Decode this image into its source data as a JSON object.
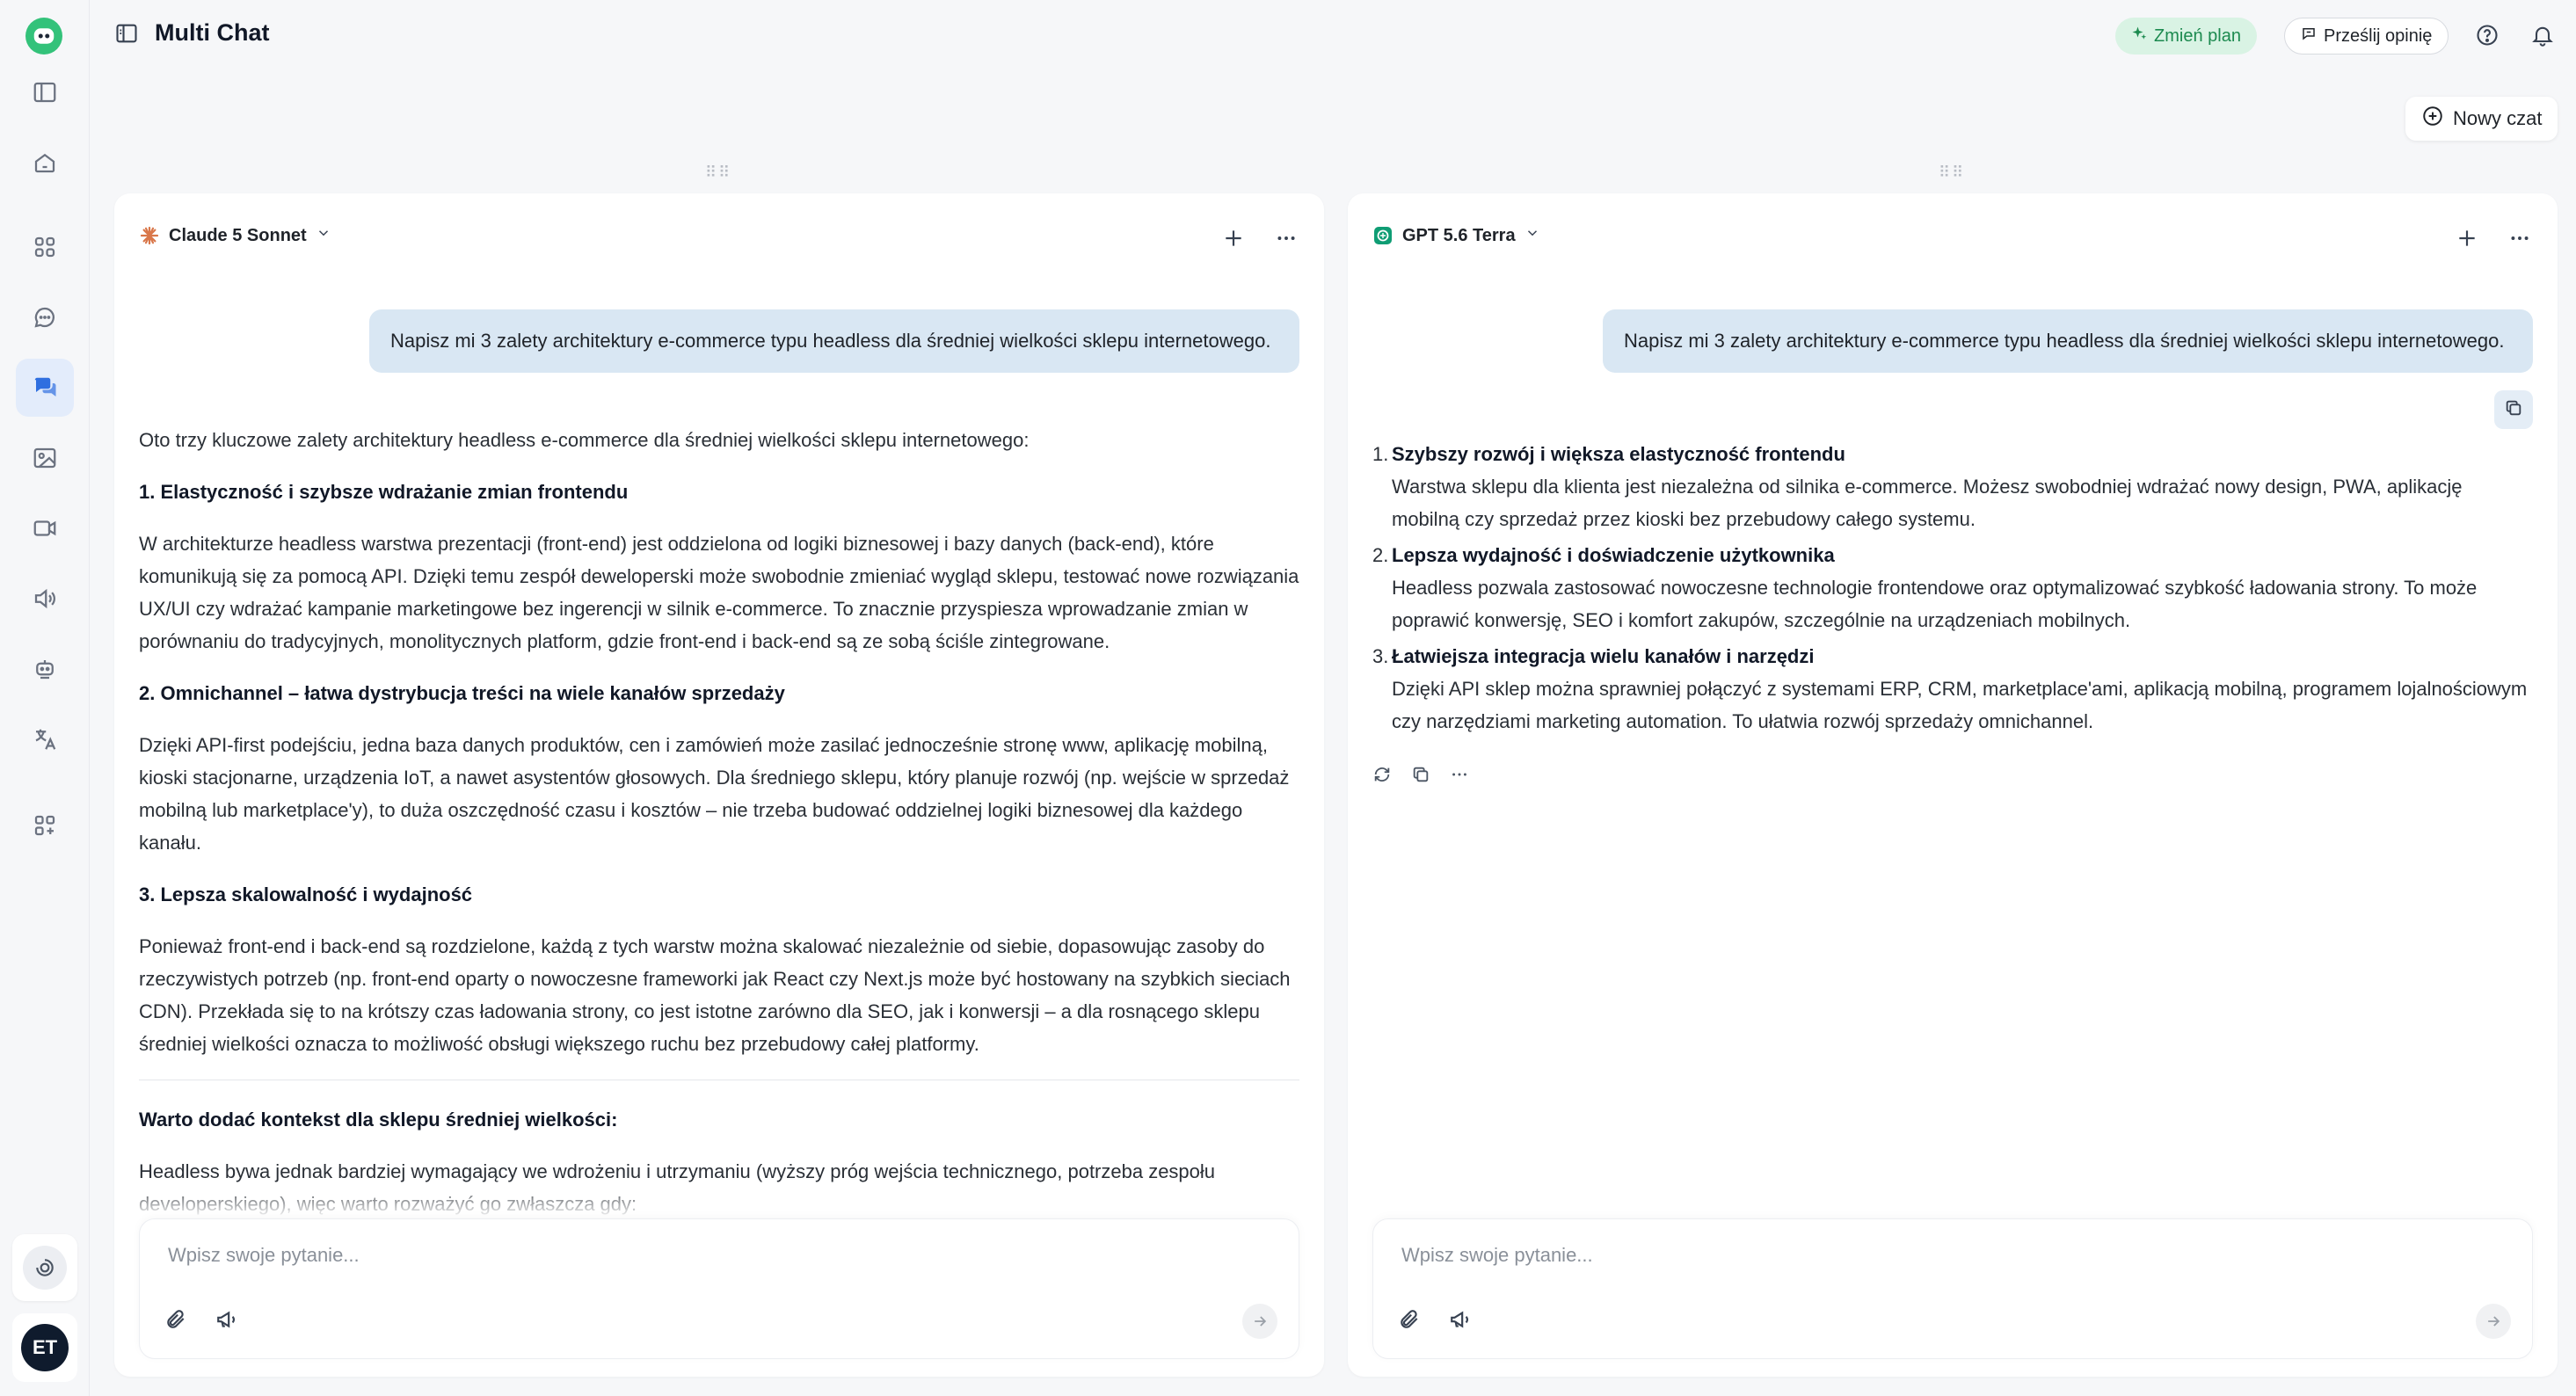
{
  "app": {
    "title": "Multi Chat"
  },
  "header": {
    "plan_label": "Zmień plan",
    "feedback_label": "Prześlij opinię",
    "new_chat_label": "Nowy czat"
  },
  "user": {
    "initials": "ET"
  },
  "colors": {
    "accent": "#2f6fe0",
    "plan_bg": "#d9f3e4",
    "plan_text": "#1c8a4f",
    "bubble": "#d9e7f3"
  },
  "sidebar": {
    "items": [
      {
        "icon": "panel-toggle-icon"
      },
      {
        "icon": "home-icon"
      },
      {
        "icon": "grid-icon"
      },
      {
        "icon": "chat-icon"
      },
      {
        "icon": "multi-chat-icon",
        "active": true
      },
      {
        "icon": "image-icon"
      },
      {
        "icon": "video-icon"
      },
      {
        "icon": "audio-icon"
      },
      {
        "icon": "robot-icon"
      },
      {
        "icon": "translate-icon"
      },
      {
        "icon": "add-apps-icon"
      }
    ]
  },
  "panels": [
    {
      "model": "Claude 5 Sonnet",
      "prompt": "Napisz mi 3 zalety architektury e-commerce typu headless dla średniej wielkości sklepu internetowego.",
      "intro": "Oto trzy kluczowe zalety architektury headless e-commerce dla średniej wielkości sklepu internetowego:",
      "sections": [
        {
          "heading": "1. Elastyczność i szybsze wdrażanie zmian frontendu",
          "body": "W architekturze headless warstwa prezentacji (front-end) jest oddzielona od logiki biznesowej i bazy danych (back-end), które komunikują się za pomocą API. Dzięki temu zespół deweloperski może swobodnie zmieniać wygląd sklepu, testować nowe rozwiązania UX/UI czy wdrażać kampanie marketingowe bez ingerencji w silnik e-commerce. To znacznie przyspiesza wprowadzanie zmian w porównaniu do tradycyjnych, monolitycznych platform, gdzie front-end i back-end są ze sobą ściśle zintegrowane."
        },
        {
          "heading": "2. Omnichannel – łatwa dystrybucja treści na wiele kanałów sprzedaży",
          "body": "Dzięki API-first podejściu, jedna baza danych produktów, cen i zamówień może zasilać jednocześnie stronę www, aplikację mobilną, kioski stacjonarne, urządzenia IoT, a nawet asystentów głosowych. Dla średniego sklepu, który planuje rozwój (np. wejście w sprzedaż mobilną lub marketplace'y), to duża oszczędność czasu i kosztów – nie trzeba budować oddzielnej logiki biznesowej dla każdego kanału."
        },
        {
          "heading": "3. Lepsza skalowalność i wydajność",
          "body": "Ponieważ front-end i back-end są rozdzielone, każdą z tych warstw można skalować niezależnie od siebie, dopasowując zasoby do rzeczywistych potrzeb (np. front-end oparty o nowoczesne frameworki jak React czy Next.js może być hostowany na szybkich sieciach CDN). Przekłada się to na krótszy czas ładowania strony, co jest istotne zarówno dla SEO, jak i konwersji – a dla rosnącego sklepu średniej wielkości oznacza to możliwość obsługi większego ruchu bez przebudowy całej platformy."
        }
      ],
      "context_heading": "Warto dodać kontekst dla sklepu średniej wielkości:",
      "context_body": "Headless bywa jednak bardziej wymagający we wdrożeniu i utrzymaniu (wyższy próg wejścia technicznego, potrzeba zespołu developerskiego), więc warto rozważyć go zwłaszcza gdy:",
      "input_placeholder": "Wpisz swoje pytanie..."
    },
    {
      "model": "GPT 5.6 Terra",
      "prompt": "Napisz mi 3 zalety architektury e-commerce typu headless dla średniej wielkości sklepu internetowego.",
      "items": [
        {
          "num": "1.",
          "title": "Szybszy rozwój i większa elastyczność frontendu",
          "body": "Warstwa sklepu dla klienta jest niezależna od silnika e-commerce. Możesz swobodniej wdrażać nowy design, PWA, aplikację mobilną czy sprzedaż przez kioski bez przebudowy całego systemu."
        },
        {
          "num": "2.",
          "title": "Lepsza wydajność i doświadczenie użytkownika",
          "body": "Headless pozwala zastosować nowoczesne technologie frontendowe oraz optymalizować szybkość ładowania strony. To może poprawić konwersję, SEO i komfort zakupów, szczególnie na urządzeniach mobilnych."
        },
        {
          "num": "3.",
          "title": "Łatwiejsza integracja wielu kanałów i narzędzi",
          "body": "Dzięki API sklep można sprawniej połączyć z systemami ERP, CRM, marketplace'ami, aplikacją mobilną, programem lojalnościowym czy narzędziami marketing automation. To ułatwia rozwój sprzedaży omnichannel."
        }
      ],
      "input_placeholder": "Wpisz swoje pytanie..."
    }
  ]
}
